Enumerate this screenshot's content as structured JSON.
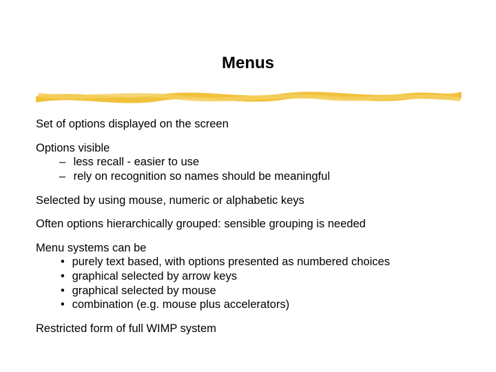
{
  "title": "Menus",
  "p1": "Set of options displayed on the screen",
  "p2": {
    "lead": "Options visible",
    "a": " less recall - easier to use",
    "b": " rely on recognition so names should be meaningful"
  },
  "p3": "Selected by using mouse, numeric or alphabetic keys",
  "p4": "Often options hierarchically grouped: sensible grouping is needed",
  "p5": {
    "lead": "Menu systems can be",
    "a": " purely text based, with options presented as numbered choices",
    "b": " graphical selected by arrow keys",
    "c": " graphical selected by mouse",
    "d": " combination  (e.g. mouse plus accelerators)"
  },
  "p6": "Restricted form of full WIMP system"
}
